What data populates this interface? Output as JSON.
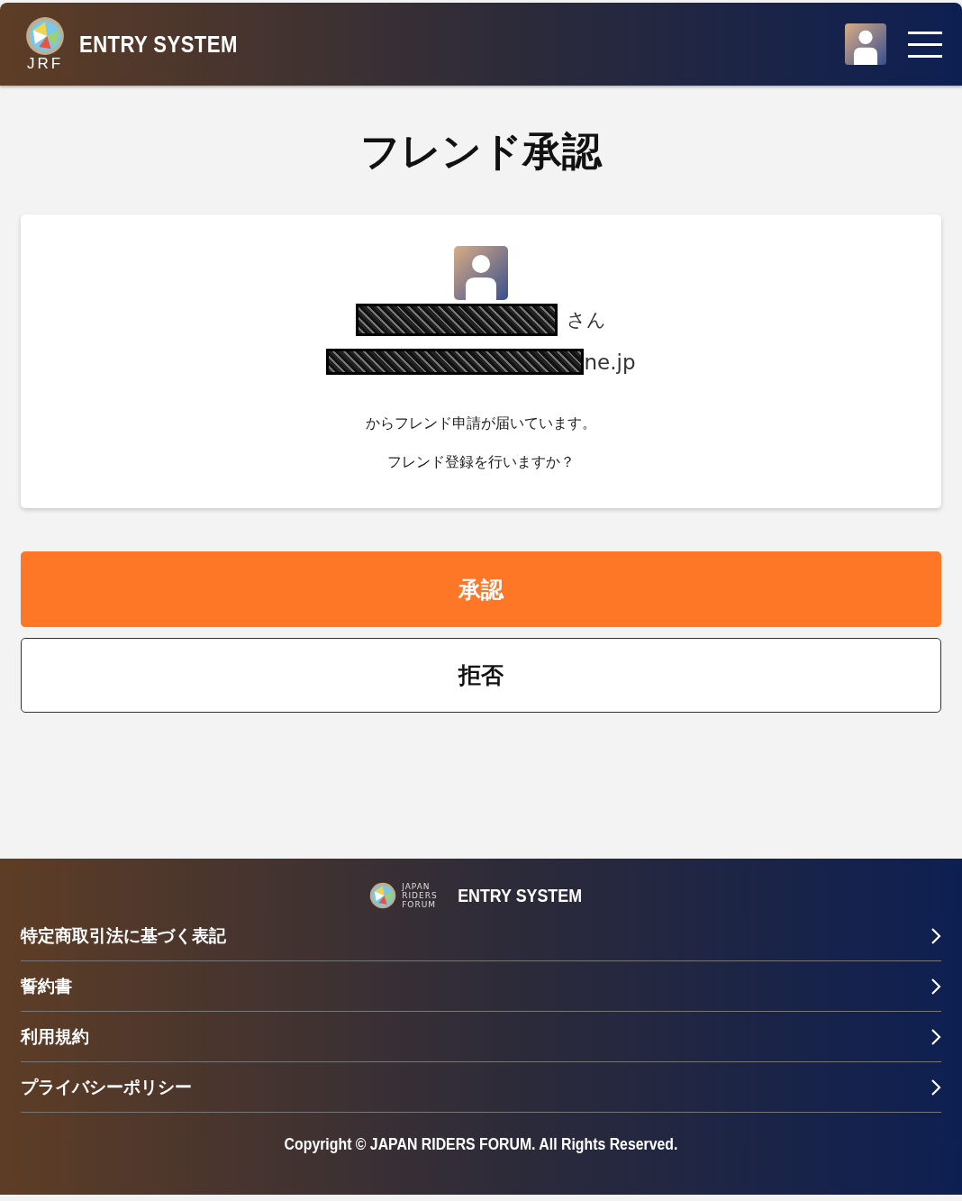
{
  "header": {
    "logo_text": "JRF",
    "title": "ENTRY SYSTEM"
  },
  "page_title": "フレンド承認",
  "request": {
    "name_suffix": "さん",
    "email_tail": "ne.jp",
    "messages": [
      "からフレンド申請が届いています。",
      "フレンド登録を行いますか？"
    ]
  },
  "buttons": [
    {
      "label": "承認",
      "kind": "primary"
    },
    {
      "label": "拒否",
      "kind": "secondary"
    }
  ],
  "footer": {
    "logo_lines": [
      "JAPAN",
      "RIDERS",
      "FORUM"
    ],
    "title": "ENTRY SYSTEM",
    "links": [
      "特定商取引法に基づく表記",
      "誓約書",
      "利用規約",
      "プライバシーポリシー"
    ],
    "copyright": "Copyright © JAPAN RIDERS FORUM. All Rights Reserved."
  }
}
